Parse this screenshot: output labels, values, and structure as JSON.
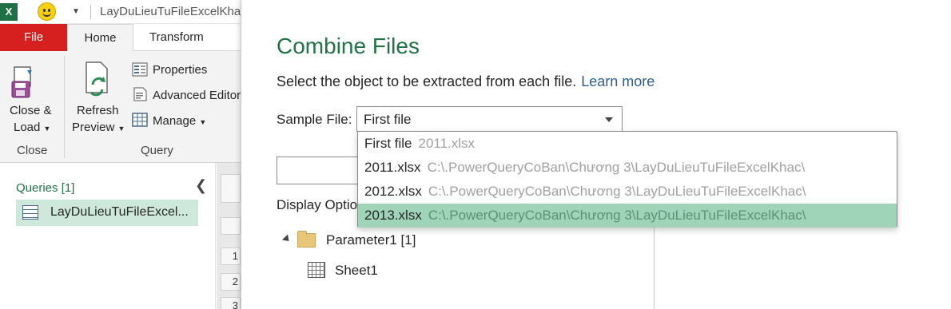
{
  "qat": {
    "app_icon": "excel-x-icon",
    "window_title": "LayDuLieuTuFileExcelKhac"
  },
  "ribbon": {
    "tabs": {
      "file": "File",
      "home": "Home",
      "transform": "Transform"
    },
    "close_load": {
      "line1": "Close &",
      "line2": "Load"
    },
    "refresh_preview": {
      "line1": "Refresh",
      "line2": "Preview"
    },
    "properties": "Properties",
    "advanced_editor": "Advanced Editor",
    "manage": "Manage",
    "group_close": "Close",
    "group_query": "Query"
  },
  "queries": {
    "header": "Queries [1]",
    "items": [
      {
        "label": "LayDuLieuTuFileExcel..."
      }
    ]
  },
  "preview_rows": [
    "1",
    "2",
    "3"
  ],
  "dialog": {
    "title": "Combine Files",
    "instruction": "Select the object to be extracted from each file.",
    "learn_more": "Learn more",
    "sample_file_label": "Sample File:",
    "sample_file_value": "First file",
    "display_options": "Display Options",
    "dropdown": [
      {
        "name": "First file",
        "detail": "2011.xlsx"
      },
      {
        "name": "2011.xlsx",
        "detail": "C:\\.PowerQueryCoBan\\Chương 3\\LayDuLieuTuFileExcelKhac\\"
      },
      {
        "name": "2012.xlsx",
        "detail": "C:\\.PowerQueryCoBan\\Chương 3\\LayDuLieuTuFileExcelKhac\\"
      },
      {
        "name": "2013.xlsx",
        "detail": "C:\\.PowerQueryCoBan\\Chương 3\\LayDuLieuTuFileExcelKhac\\",
        "selected": true
      }
    ],
    "tree": {
      "parameter": "Parameter1 [1]",
      "sheet": "Sheet1"
    }
  }
}
